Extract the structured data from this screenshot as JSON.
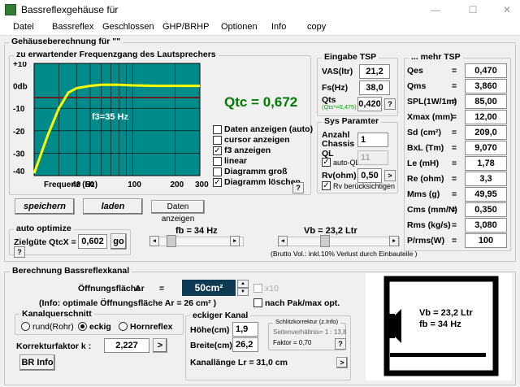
{
  "window": {
    "title": "Bassreflexgehäuse für"
  },
  "menu": [
    "Datei",
    "Bassreflex",
    "Geschlossen",
    "GHP/BRHP",
    "Optionen",
    "Info",
    "copy"
  ],
  "calc": {
    "title": "Gehäuseberechnung für \"\"",
    "freq_title": "zu erwartender Frequenzgang des Lautsprechers",
    "qtc_label": "Qtc = 0,672"
  },
  "chart_data": {
    "type": "line",
    "ylabels": [
      "+10",
      "0db",
      "-10",
      "-20",
      "-30",
      "-40"
    ],
    "ylim": [
      -40,
      10
    ],
    "xticks": [
      40,
      50,
      100,
      200,
      300
    ],
    "x_title": "Frequenz (Hz)",
    "annotation": "f3=35 Hz",
    "series": [
      {
        "x": [
          20,
          25,
          30,
          35,
          40,
          50,
          60,
          80,
          100,
          150,
          200,
          300
        ],
        "values": [
          -39,
          -22,
          -10,
          -3,
          -1,
          0,
          0.5,
          0.5,
          0.2,
          0,
          0,
          0
        ]
      }
    ]
  },
  "chart_options": [
    {
      "label": "Daten anzeigen (auto)",
      "checked": false
    },
    {
      "label": "cursor anzeigen",
      "checked": false
    },
    {
      "label": "f3 anzeigen",
      "checked": true
    },
    {
      "label": "linear",
      "checked": false
    },
    {
      "label": "Diagramm groß",
      "checked": false
    },
    {
      "label": "Diagramm  löschen",
      "checked": true
    }
  ],
  "help_q": "?",
  "buttons": {
    "speichern": "speichern",
    "laden": "laden",
    "daten": "Daten anzeigen",
    "go": "go",
    "br_info": "BR Info",
    "arrow": ">"
  },
  "eingabe": {
    "title": "Eingabe TSP",
    "vas_label": "VAS(ltr)",
    "vas": "21,2",
    "fs_label": "Fs(Hz)",
    "fs": "38,0",
    "qts_label": "Qts",
    "qts_sub": "(Qts*=0,475)",
    "qts": "0,420"
  },
  "sys": {
    "title": "Sys Paramter",
    "anzahl_label": "Anzahl Chassis",
    "anzahl": "1",
    "ql_label": "QL",
    "auto_ql": "auto-QL",
    "ql": "11",
    "rv_label": "Rv(ohm)",
    "rv": "0,50",
    "rv_check": "Rv berücksichtigen"
  },
  "mehr": {
    "title": "... mehr TSP",
    "rows": [
      {
        "label": "Qes",
        "value": "0,470"
      },
      {
        "label": "Qms",
        "value": "3,860"
      },
      {
        "label": "SPL(1W/1m)",
        "value": "85,00"
      },
      {
        "label": "Xmax (mm)",
        "value": "12,00"
      },
      {
        "label": "Sd (cm²)",
        "value": "209,0"
      },
      {
        "label": "BxL  (Tm)",
        "value": "9,070"
      },
      {
        "label": "Le (mH)",
        "value": "1,78"
      },
      {
        "label": "Re (ohm)",
        "value": "3,3"
      },
      {
        "label": "Mms  (g)",
        "value": "49,95"
      },
      {
        "label": "Cms (mm/N)",
        "value": "0,350"
      },
      {
        "label": "Rms  (kg/s)",
        "value": "3,080"
      },
      {
        "label": "P/rms(W)",
        "value": "100"
      }
    ],
    "eq": "="
  },
  "optimize": {
    "title": "auto optimize",
    "zielgute": "Zielgüte QtcX =",
    "value": "0,602"
  },
  "sliders": {
    "fb_label": "fb =  34 Hz",
    "fb": 0.12,
    "vb_label": "Vb = 23,2 Ltr",
    "vb": 0.35,
    "brutto": "(Brutto Vol.: inkl.10% Verlust durch Einbauteile )"
  },
  "bkanal": {
    "title": "Berechnung  Bassreflexkanal",
    "flaeche_label": "Öffnungsfläche",
    "ar_label": "Ar",
    "eq": "=",
    "ar": "50cm²",
    "x10": "x10",
    "info": "(Info: optimale Öffnungsfläche   Ar = 26 cm² )",
    "nach_pak": "nach Pak/max opt.",
    "kq_title": "Kanalquerschnitt",
    "radio": [
      "rund(Rohr)",
      "eckig",
      "Hornreflex"
    ],
    "korrektur_label": "Korrekturfaktor k :",
    "korrektur": "2,227"
  },
  "eckig": {
    "title": "eckiger Kanal",
    "hoehe_label": "Höhe(cm)",
    "hoehe": "1,9",
    "breite_label": "Breite(cm)",
    "breite": "26,2",
    "schlitz_title": "Schlitzkorrektur (z.Info)",
    "seiten": "Seitenverhältnis= 1 : 13,8",
    "faktor": "Faktor = 0,70",
    "kanallaenge": "Kanallänge   Lr =  31,0 cm"
  },
  "diagram": {
    "vb": "Vb = 23,2 Ltr",
    "fb": "fb =  34 Hz"
  },
  "colors": {
    "plot_bg": "#008b8b",
    "curve": "#ffff00",
    "accent_field": "#0f3a54",
    "qtc": "#007a00"
  }
}
